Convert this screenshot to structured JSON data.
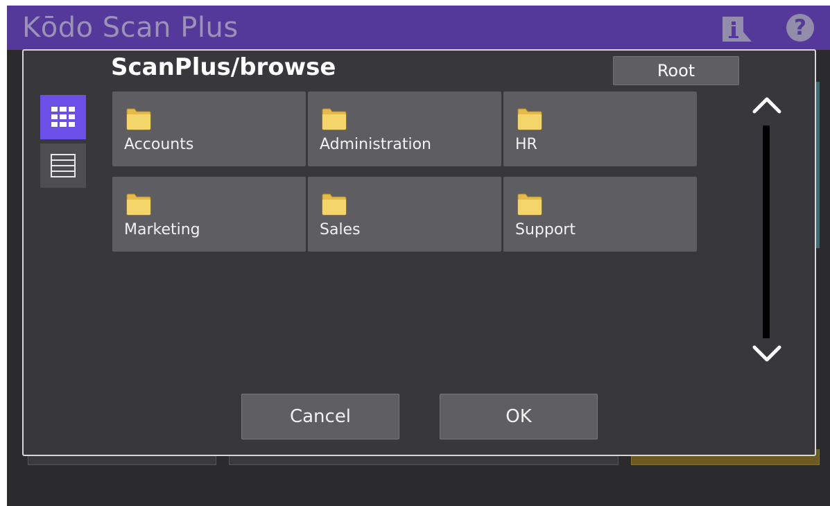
{
  "app": {
    "title": "Kōdo Scan Plus"
  },
  "header": {
    "help_label": "?",
    "info_icon": "info-document-icon",
    "help_icon": "help-circle-icon"
  },
  "dialog": {
    "path": "ScanPlus/browse",
    "root_label": "Root",
    "view_modes": [
      {
        "id": "grid",
        "icon": "grid-view-icon",
        "active": true
      },
      {
        "id": "list",
        "icon": "list-view-icon",
        "active": false
      }
    ],
    "folders": [
      {
        "name": "Accounts",
        "icon": "folder-icon"
      },
      {
        "name": "Administration",
        "icon": "folder-icon"
      },
      {
        "name": "HR",
        "icon": "folder-icon"
      },
      {
        "name": "Marketing",
        "icon": "folder-icon"
      },
      {
        "name": "Sales",
        "icon": "folder-icon"
      },
      {
        "name": "Support",
        "icon": "folder-icon"
      }
    ],
    "cancel_label": "Cancel",
    "ok_label": "OK"
  },
  "colors": {
    "titlebar": "#54399a",
    "dialog_bg": "#38383c",
    "tile_bg": "#5d5d62",
    "active_view": "#6b4fe6",
    "folder_yellow": "#f4d56a"
  }
}
